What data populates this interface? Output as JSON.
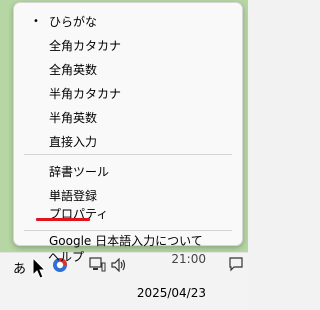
{
  "menu": {
    "input_modes": [
      {
        "label": "ひらがな",
        "selected": true
      },
      {
        "label": "全角カタカナ",
        "selected": false
      },
      {
        "label": "全角英数",
        "selected": false
      },
      {
        "label": "半角カタカナ",
        "selected": false
      },
      {
        "label": "半角英数",
        "selected": false
      },
      {
        "label": "直接入力",
        "selected": false
      }
    ],
    "bullet": "•",
    "tools": [
      {
        "label": "辞書ツール"
      },
      {
        "label": "単語登録"
      },
      {
        "label": "プロパティ"
      }
    ],
    "about": [
      {
        "label": "Google 日本語入力について"
      },
      {
        "label": "ヘルプ"
      }
    ]
  },
  "taskbar": {
    "ime_indicator": "あ",
    "time": "21:00",
    "date": "2025/04/23"
  },
  "colors": {
    "highlight_underline": "#e0151b",
    "background_green": "#b6d7a3"
  }
}
